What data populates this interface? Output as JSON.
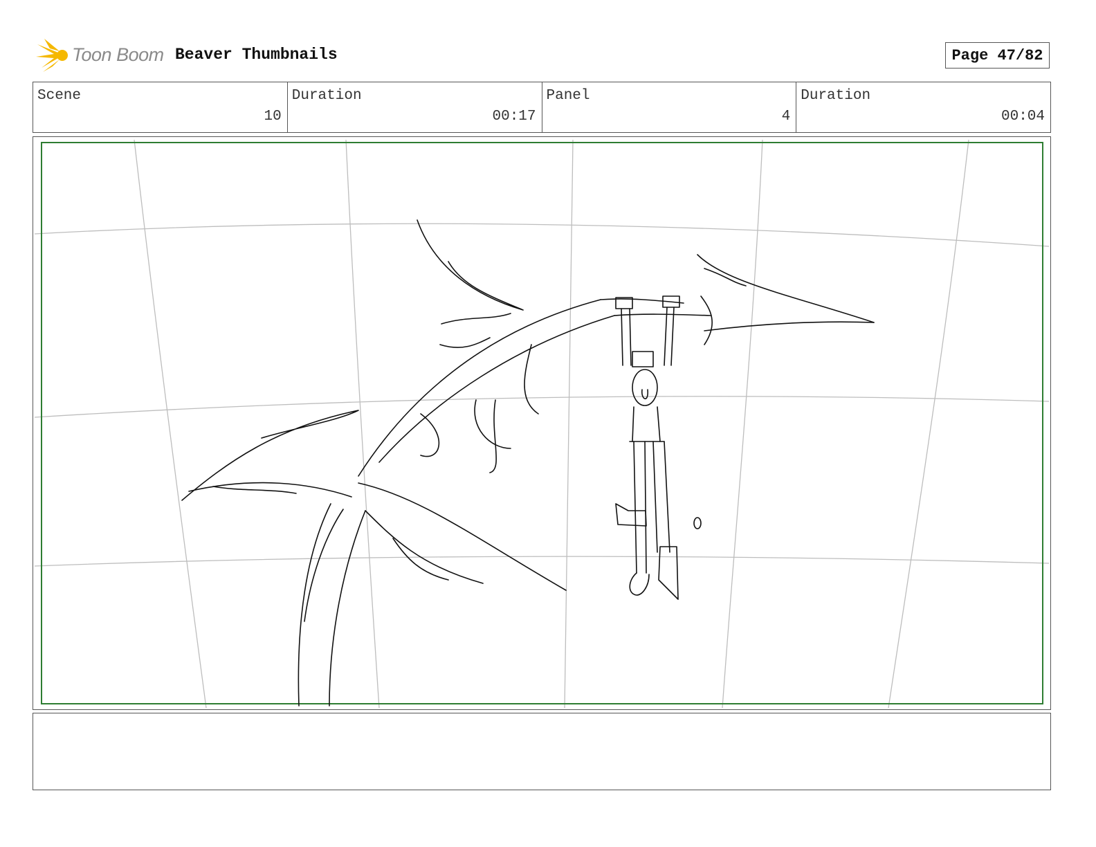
{
  "header": {
    "logo_text": "Toon Boom",
    "title": "Beaver Thumbnails",
    "page_label": "Page 47/82"
  },
  "info": [
    {
      "label": "Scene",
      "value": "10"
    },
    {
      "label": "Duration",
      "value": "00:17"
    },
    {
      "label": "Panel",
      "value": "4"
    },
    {
      "label": "Duration",
      "value": "00:04"
    }
  ],
  "panel": {
    "safe_frame_color": "#2e7d32",
    "grid_color": "#bdbdbd",
    "ink_color": "#111111"
  },
  "notes": {
    "text": ""
  },
  "colors": {
    "logo_flame": "#f5b800",
    "logo_text": "#8a8a8a",
    "border": "#555555"
  }
}
